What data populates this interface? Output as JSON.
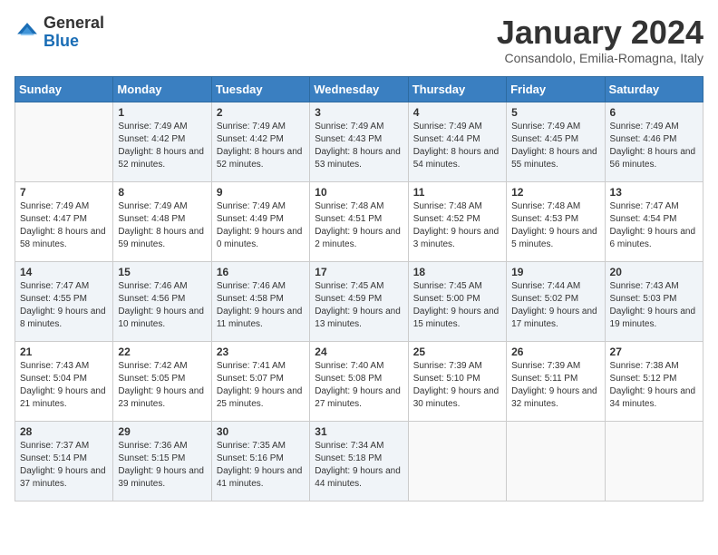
{
  "logo": {
    "general": "General",
    "blue": "Blue"
  },
  "title": "January 2024",
  "location": "Consandolo, Emilia-Romagna, Italy",
  "weekdays": [
    "Sunday",
    "Monday",
    "Tuesday",
    "Wednesday",
    "Thursday",
    "Friday",
    "Saturday"
  ],
  "weeks": [
    [
      {
        "day": "",
        "sunrise": "",
        "sunset": "",
        "daylight": ""
      },
      {
        "day": "1",
        "sunrise": "Sunrise: 7:49 AM",
        "sunset": "Sunset: 4:42 PM",
        "daylight": "Daylight: 8 hours and 52 minutes."
      },
      {
        "day": "2",
        "sunrise": "Sunrise: 7:49 AM",
        "sunset": "Sunset: 4:42 PM",
        "daylight": "Daylight: 8 hours and 52 minutes."
      },
      {
        "day": "3",
        "sunrise": "Sunrise: 7:49 AM",
        "sunset": "Sunset: 4:43 PM",
        "daylight": "Daylight: 8 hours and 53 minutes."
      },
      {
        "day": "4",
        "sunrise": "Sunrise: 7:49 AM",
        "sunset": "Sunset: 4:44 PM",
        "daylight": "Daylight: 8 hours and 54 minutes."
      },
      {
        "day": "5",
        "sunrise": "Sunrise: 7:49 AM",
        "sunset": "Sunset: 4:45 PM",
        "daylight": "Daylight: 8 hours and 55 minutes."
      },
      {
        "day": "6",
        "sunrise": "Sunrise: 7:49 AM",
        "sunset": "Sunset: 4:46 PM",
        "daylight": "Daylight: 8 hours and 56 minutes."
      }
    ],
    [
      {
        "day": "7",
        "sunrise": "Sunrise: 7:49 AM",
        "sunset": "Sunset: 4:47 PM",
        "daylight": "Daylight: 8 hours and 58 minutes."
      },
      {
        "day": "8",
        "sunrise": "Sunrise: 7:49 AM",
        "sunset": "Sunset: 4:48 PM",
        "daylight": "Daylight: 8 hours and 59 minutes."
      },
      {
        "day": "9",
        "sunrise": "Sunrise: 7:49 AM",
        "sunset": "Sunset: 4:49 PM",
        "daylight": "Daylight: 9 hours and 0 minutes."
      },
      {
        "day": "10",
        "sunrise": "Sunrise: 7:48 AM",
        "sunset": "Sunset: 4:51 PM",
        "daylight": "Daylight: 9 hours and 2 minutes."
      },
      {
        "day": "11",
        "sunrise": "Sunrise: 7:48 AM",
        "sunset": "Sunset: 4:52 PM",
        "daylight": "Daylight: 9 hours and 3 minutes."
      },
      {
        "day": "12",
        "sunrise": "Sunrise: 7:48 AM",
        "sunset": "Sunset: 4:53 PM",
        "daylight": "Daylight: 9 hours and 5 minutes."
      },
      {
        "day": "13",
        "sunrise": "Sunrise: 7:47 AM",
        "sunset": "Sunset: 4:54 PM",
        "daylight": "Daylight: 9 hours and 6 minutes."
      }
    ],
    [
      {
        "day": "14",
        "sunrise": "Sunrise: 7:47 AM",
        "sunset": "Sunset: 4:55 PM",
        "daylight": "Daylight: 9 hours and 8 minutes."
      },
      {
        "day": "15",
        "sunrise": "Sunrise: 7:46 AM",
        "sunset": "Sunset: 4:56 PM",
        "daylight": "Daylight: 9 hours and 10 minutes."
      },
      {
        "day": "16",
        "sunrise": "Sunrise: 7:46 AM",
        "sunset": "Sunset: 4:58 PM",
        "daylight": "Daylight: 9 hours and 11 minutes."
      },
      {
        "day": "17",
        "sunrise": "Sunrise: 7:45 AM",
        "sunset": "Sunset: 4:59 PM",
        "daylight": "Daylight: 9 hours and 13 minutes."
      },
      {
        "day": "18",
        "sunrise": "Sunrise: 7:45 AM",
        "sunset": "Sunset: 5:00 PM",
        "daylight": "Daylight: 9 hours and 15 minutes."
      },
      {
        "day": "19",
        "sunrise": "Sunrise: 7:44 AM",
        "sunset": "Sunset: 5:02 PM",
        "daylight": "Daylight: 9 hours and 17 minutes."
      },
      {
        "day": "20",
        "sunrise": "Sunrise: 7:43 AM",
        "sunset": "Sunset: 5:03 PM",
        "daylight": "Daylight: 9 hours and 19 minutes."
      }
    ],
    [
      {
        "day": "21",
        "sunrise": "Sunrise: 7:43 AM",
        "sunset": "Sunset: 5:04 PM",
        "daylight": "Daylight: 9 hours and 21 minutes."
      },
      {
        "day": "22",
        "sunrise": "Sunrise: 7:42 AM",
        "sunset": "Sunset: 5:05 PM",
        "daylight": "Daylight: 9 hours and 23 minutes."
      },
      {
        "day": "23",
        "sunrise": "Sunrise: 7:41 AM",
        "sunset": "Sunset: 5:07 PM",
        "daylight": "Daylight: 9 hours and 25 minutes."
      },
      {
        "day": "24",
        "sunrise": "Sunrise: 7:40 AM",
        "sunset": "Sunset: 5:08 PM",
        "daylight": "Daylight: 9 hours and 27 minutes."
      },
      {
        "day": "25",
        "sunrise": "Sunrise: 7:39 AM",
        "sunset": "Sunset: 5:10 PM",
        "daylight": "Daylight: 9 hours and 30 minutes."
      },
      {
        "day": "26",
        "sunrise": "Sunrise: 7:39 AM",
        "sunset": "Sunset: 5:11 PM",
        "daylight": "Daylight: 9 hours and 32 minutes."
      },
      {
        "day": "27",
        "sunrise": "Sunrise: 7:38 AM",
        "sunset": "Sunset: 5:12 PM",
        "daylight": "Daylight: 9 hours and 34 minutes."
      }
    ],
    [
      {
        "day": "28",
        "sunrise": "Sunrise: 7:37 AM",
        "sunset": "Sunset: 5:14 PM",
        "daylight": "Daylight: 9 hours and 37 minutes."
      },
      {
        "day": "29",
        "sunrise": "Sunrise: 7:36 AM",
        "sunset": "Sunset: 5:15 PM",
        "daylight": "Daylight: 9 hours and 39 minutes."
      },
      {
        "day": "30",
        "sunrise": "Sunrise: 7:35 AM",
        "sunset": "Sunset: 5:16 PM",
        "daylight": "Daylight: 9 hours and 41 minutes."
      },
      {
        "day": "31",
        "sunrise": "Sunrise: 7:34 AM",
        "sunset": "Sunset: 5:18 PM",
        "daylight": "Daylight: 9 hours and 44 minutes."
      },
      {
        "day": "",
        "sunrise": "",
        "sunset": "",
        "daylight": ""
      },
      {
        "day": "",
        "sunrise": "",
        "sunset": "",
        "daylight": ""
      },
      {
        "day": "",
        "sunrise": "",
        "sunset": "",
        "daylight": ""
      }
    ]
  ]
}
